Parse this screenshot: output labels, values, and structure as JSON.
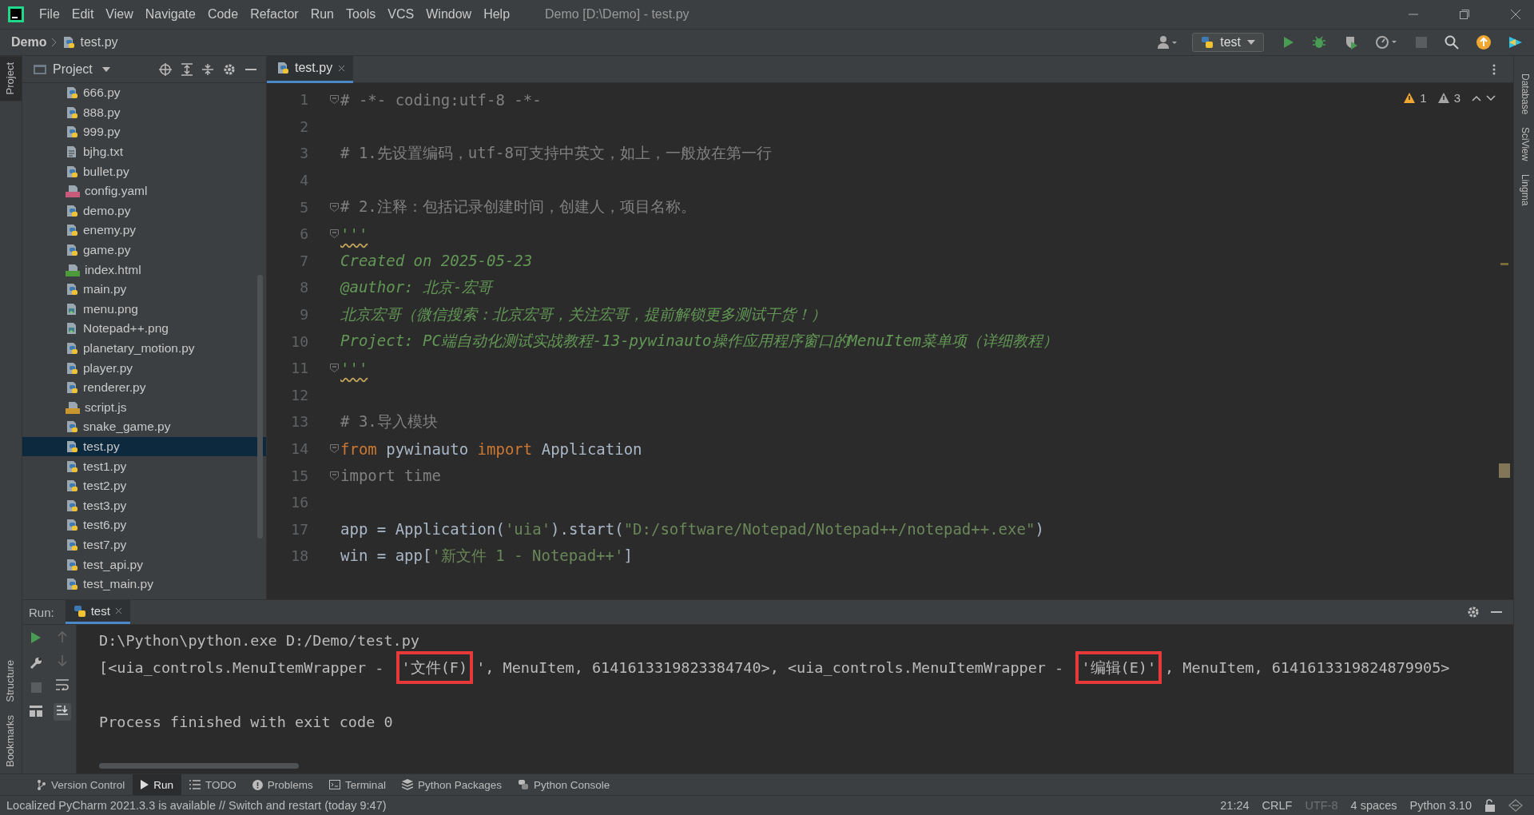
{
  "title_bar": {
    "menu": [
      "File",
      "Edit",
      "View",
      "Navigate",
      "Code",
      "Refactor",
      "Run",
      "Tools",
      "VCS",
      "Window",
      "Help"
    ],
    "title": "Demo [D:\\Demo] - test.py"
  },
  "nav_bar": {
    "breadcrumb": [
      "Demo",
      "test.py"
    ],
    "run_config": "test"
  },
  "left_stripe": [
    {
      "label": "Project",
      "selected": true
    },
    {
      "label": "Structure",
      "selected": false
    },
    {
      "label": "Bookmarks",
      "selected": false
    }
  ],
  "right_stripe": [
    "Database",
    "SciView",
    "Lingma"
  ],
  "project_panel": {
    "title": "Project",
    "files": [
      {
        "name": "666.py",
        "kind": "python",
        "selected": false
      },
      {
        "name": "888.py",
        "kind": "python",
        "selected": false
      },
      {
        "name": "999.py",
        "kind": "python",
        "selected": false
      },
      {
        "name": "bjhg.txt",
        "kind": "text",
        "selected": false
      },
      {
        "name": "bullet.py",
        "kind": "python",
        "selected": false
      },
      {
        "name": "config.yaml",
        "kind": "yaml",
        "selected": false
      },
      {
        "name": "demo.py",
        "kind": "python",
        "selected": false
      },
      {
        "name": "enemy.py",
        "kind": "python",
        "selected": false
      },
      {
        "name": "game.py",
        "kind": "python",
        "selected": false
      },
      {
        "name": "index.html",
        "kind": "html",
        "selected": false
      },
      {
        "name": "main.py",
        "kind": "python",
        "selected": false
      },
      {
        "name": "menu.png",
        "kind": "image",
        "selected": false
      },
      {
        "name": "Notepad++.png",
        "kind": "image",
        "selected": false
      },
      {
        "name": "planetary_motion.py",
        "kind": "python",
        "selected": false
      },
      {
        "name": "player.py",
        "kind": "python",
        "selected": false
      },
      {
        "name": "renderer.py",
        "kind": "python",
        "selected": false
      },
      {
        "name": "script.js",
        "kind": "js",
        "selected": false
      },
      {
        "name": "snake_game.py",
        "kind": "python",
        "selected": false
      },
      {
        "name": "test.py",
        "kind": "python",
        "selected": true
      },
      {
        "name": "test1.py",
        "kind": "python",
        "selected": false
      },
      {
        "name": "test2.py",
        "kind": "python",
        "selected": false
      },
      {
        "name": "test3.py",
        "kind": "python",
        "selected": false
      },
      {
        "name": "test6.py",
        "kind": "python",
        "selected": false
      },
      {
        "name": "test7.py",
        "kind": "python",
        "selected": false
      },
      {
        "name": "test_api.py",
        "kind": "python",
        "selected": false
      },
      {
        "name": "test_main.py",
        "kind": "python",
        "selected": false
      }
    ]
  },
  "editor": {
    "tab": "test.py",
    "warnings": "1",
    "weak_warnings": "3",
    "lines": [
      {
        "number": "1",
        "fold": true,
        "tokens": [
          {
            "text": "# -*- coding:utf-8 -*-",
            "kind": "comment"
          }
        ]
      },
      {
        "number": "2",
        "fold": false
      },
      {
        "number": "3",
        "fold": false,
        "tokens": [
          {
            "text": "# 1.先设置编码，utf-8可支持中英文，如上，一般放在第一行",
            "kind": "comment"
          }
        ]
      },
      {
        "number": "4",
        "fold": false
      },
      {
        "number": "5",
        "fold": true,
        "tokens": [
          {
            "text": "# 2.注释：包括记录创建时间，创建人，项目名称。",
            "kind": "comment"
          }
        ]
      },
      {
        "number": "6",
        "fold": true,
        "tokens": [
          {
            "text": "'''",
            "kind": "docstring",
            "squiggly": true
          }
        ]
      },
      {
        "number": "7",
        "fold": false,
        "tokens": [
          {
            "text": "Created on 2025-05-23",
            "kind": "docstring"
          }
        ]
      },
      {
        "number": "8",
        "fold": false,
        "tokens": [
          {
            "text": "@author: 北京-宏哥",
            "kind": "docstring"
          }
        ]
      },
      {
        "number": "9",
        "fold": false,
        "tokens": [
          {
            "text": "北京宏哥（微信搜索：北京宏哥，关注宏哥，提前解锁更多测试干货！）",
            "kind": "docstring"
          }
        ]
      },
      {
        "number": "10",
        "fold": false,
        "tokens": [
          {
            "text": "Project: PC端自动化测试实战教程-13-pywinauto操作应用程序窗口的MenuItem菜单项（详细教程）",
            "kind": "docstring"
          }
        ]
      },
      {
        "number": "11",
        "fold": true,
        "tokens": [
          {
            "text": "'''",
            "kind": "docstring",
            "squiggly": true
          }
        ]
      },
      {
        "number": "12",
        "fold": false
      },
      {
        "number": "13",
        "fold": false,
        "tokens": [
          {
            "text": "# 3.导入模块",
            "kind": "comment"
          }
        ]
      },
      {
        "number": "14",
        "fold": true,
        "tokens": [
          {
            "text": "from",
            "kind": "keyword"
          },
          {
            "text": " pywinauto ",
            "kind": "plain"
          },
          {
            "text": "import",
            "kind": "keyword"
          },
          {
            "text": " Application",
            "kind": "plain"
          }
        ]
      },
      {
        "number": "15",
        "fold": true,
        "tokens": [
          {
            "text": "import time",
            "kind": "unused"
          }
        ]
      },
      {
        "number": "16",
        "fold": false
      },
      {
        "number": "17",
        "fold": false,
        "tokens": [
          {
            "text": "app = Application(",
            "kind": "plain"
          },
          {
            "text": "'uia'",
            "kind": "string"
          },
          {
            "text": ").start(",
            "kind": "plain"
          },
          {
            "text": "\"D:/software/Notepad/Notepad++/notepad++.exe\"",
            "kind": "string"
          },
          {
            "text": ")",
            "kind": "plain"
          }
        ]
      },
      {
        "number": "18",
        "fold": false,
        "tokens": [
          {
            "text": "win = app[",
            "kind": "plain"
          },
          {
            "text": "'新文件 1 - Notepad++'",
            "kind": "string"
          },
          {
            "text": "]",
            "kind": "plain"
          }
        ]
      }
    ]
  },
  "run_panel": {
    "label": "Run:",
    "tab": "test",
    "output": [
      {
        "blank_line_before": false,
        "segments": [
          {
            "text": "D:\\Python\\python.exe D:/Demo/test.py"
          }
        ]
      },
      {
        "blank_line_before": false,
        "segments": [
          {
            "text": "[<uia_controls.MenuItemWrapper - "
          },
          {
            "text": "'文件(F)",
            "boxed": true
          },
          {
            "text": "', MenuItem, 6141613319823384740>, <uia_controls.MenuItemWrapper - "
          },
          {
            "text": "'编辑(E)'",
            "boxed": true
          },
          {
            "text": ", MenuItem, 6141613319824879905>"
          }
        ]
      },
      {
        "blank_line_before": true,
        "segments": [
          {
            "text": "Process finished with exit code 0"
          }
        ]
      }
    ]
  },
  "tool_bar": [
    {
      "label": "Version Control",
      "kind": "vcs",
      "selected": false
    },
    {
      "label": "Run",
      "kind": "run",
      "selected": true
    },
    {
      "label": "TODO",
      "kind": "todo",
      "selected": false
    },
    {
      "label": "Problems",
      "kind": "problems",
      "selected": false
    },
    {
      "label": "Terminal",
      "kind": "terminal",
      "selected": false
    },
    {
      "label": "Python Packages",
      "kind": "packages",
      "selected": false
    },
    {
      "label": "Python Console",
      "kind": "console",
      "selected": false
    }
  ],
  "status_bar": {
    "message": "Localized PyCharm 2021.3.3 is available // Switch and restart (today 9:47)",
    "items": [
      {
        "text": "21:24",
        "disabled": false
      },
      {
        "text": "CRLF",
        "disabled": false
      },
      {
        "text": "UTF-8",
        "disabled": true
      },
      {
        "text": "4 spaces",
        "disabled": false
      },
      {
        "text": "Python 3.10",
        "disabled": false
      }
    ]
  }
}
